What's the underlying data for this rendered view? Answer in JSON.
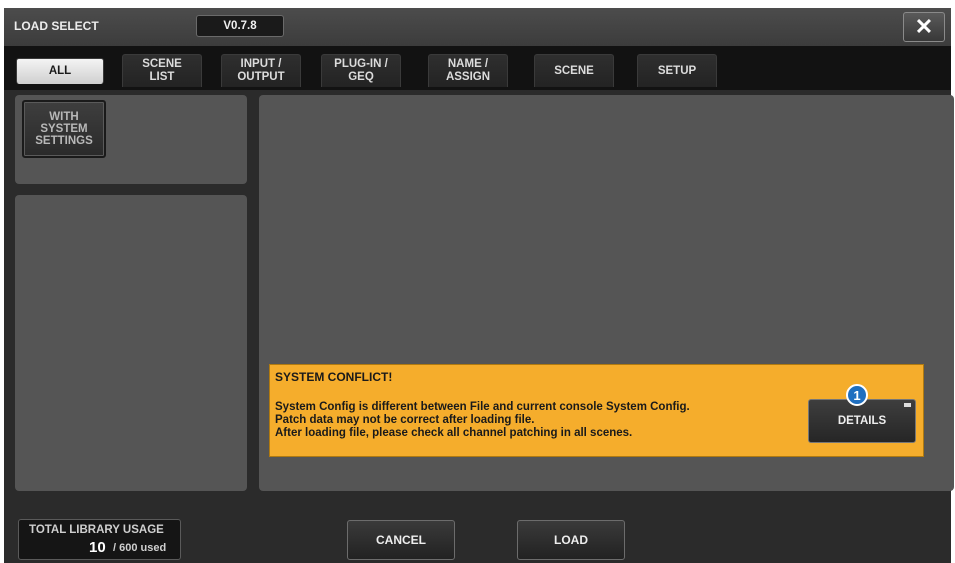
{
  "window": {
    "title": "LOAD SELECT",
    "version": "V0.7.8",
    "close_icon": "close-icon"
  },
  "tabs": [
    {
      "label": "ALL",
      "active": true
    },
    {
      "label": "SCENE\nLIST",
      "active": false
    },
    {
      "label": "INPUT /\nOUTPUT",
      "active": false
    },
    {
      "label": "PLUG-IN /\nGEQ",
      "active": false
    },
    {
      "label": "NAME /\nASSIGN",
      "active": false
    },
    {
      "label": "SCENE",
      "active": false
    },
    {
      "label": "SETUP",
      "active": false
    }
  ],
  "left_panel": {
    "with_system_settings_label": "WITH\nSYSTEM\nSETTINGS"
  },
  "warning": {
    "title": "SYSTEM CONFLICT!",
    "lines": [
      "System Config is different between File and current console System Config.",
      "Patch data may not be correct after loading file.",
      "After loading file, please check all channel patching in all scenes."
    ],
    "details_label": "DETAILS",
    "badge": "1"
  },
  "footer": {
    "usage_label": "TOTAL LIBRARY USAGE",
    "usage_count": "10",
    "usage_total": "/ 600 used",
    "cancel_label": "CANCEL",
    "load_label": "LOAD"
  },
  "colors": {
    "warning_bg": "#f5ad2c",
    "panel_bg": "#555555",
    "badge_bg": "#1f6fc0"
  }
}
